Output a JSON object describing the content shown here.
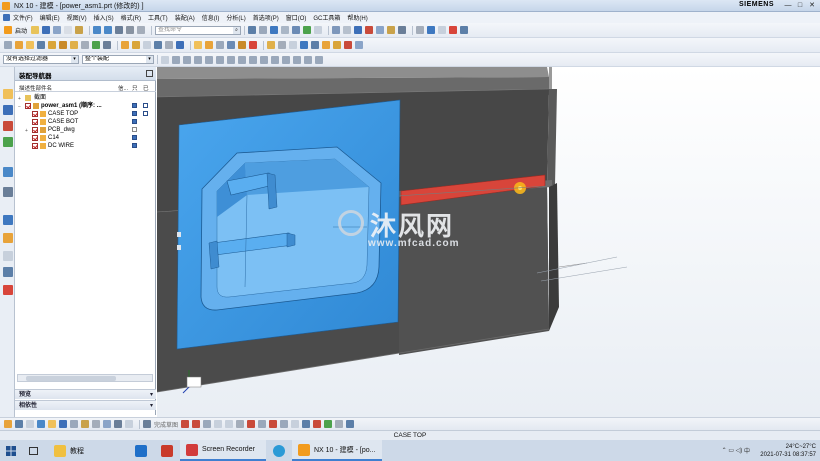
{
  "window": {
    "title": "NX 10 - 建模 - [power_asm1.prt  (修改的) ]",
    "brand": "SIEMENS",
    "controls": [
      "—",
      "□",
      "✕"
    ]
  },
  "menubar": {
    "items": [
      "文件(F)",
      "编辑(E)",
      "视图(V)",
      "插入(S)",
      "格式(R)",
      "工具(T)",
      "装配(A)",
      "信息(I)",
      "分析(L)",
      "首选项(P)",
      "窗口(O)",
      "GC工具箱",
      "帮助(H)"
    ]
  },
  "toolbar1": {
    "start_label": "启动",
    "search_placeholder": "查找命令"
  },
  "toolbar3": {
    "filter_value": "没有选择过滤器",
    "scope_value": "整个装配"
  },
  "navigator": {
    "title": "装配导航器",
    "columns": [
      "描述性部件名",
      "信...",
      "只",
      "已"
    ],
    "rows": [
      {
        "name": "截面",
        "level": 0,
        "expander": "+"
      },
      {
        "name": "power_asm1 (顺序: ...",
        "level": 0,
        "expander": "−"
      },
      {
        "name": "CASE TOP",
        "level": 1,
        "expander": ""
      },
      {
        "name": "CASE BOT",
        "level": 1,
        "expander": ""
      },
      {
        "name": "PCB_dwg",
        "level": 1,
        "expander": "+"
      },
      {
        "name": "C14",
        "level": 1,
        "expander": ""
      },
      {
        "name": "DC WIRE",
        "level": 1,
        "expander": ""
      }
    ],
    "preview_label": "预览",
    "dependency_label": "相依性"
  },
  "viewport": {
    "watermark_cn": "沐风网",
    "watermark_url": "www.mfcad.com"
  },
  "bottom_toolbar": {
    "snap_label": "完成草图"
  },
  "status": {
    "text": "CASE TOP"
  },
  "taskbar": {
    "items": [
      {
        "label": "教程",
        "icon": "folder-icon"
      },
      {
        "label": "Screen Recorder",
        "icon": "recorder-icon"
      },
      {
        "label": "NX 10 - 建模 - [po...",
        "icon": "nx-icon"
      }
    ],
    "weather": "24°C~27°C",
    "datetime": "2021-07-31 08:37:57"
  },
  "colors": {
    "accent_blue": "#3c9ae8",
    "highlight_red": "#d8453a",
    "case_gray": "#4a4a4a"
  }
}
